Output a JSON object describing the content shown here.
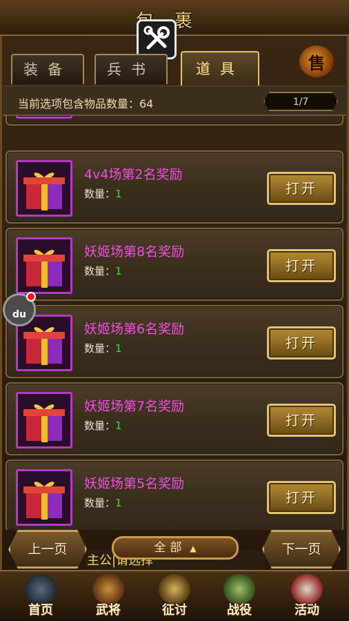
{
  "window": {
    "title": "包裹"
  },
  "tabs": [
    {
      "label": "装备",
      "active": false
    },
    {
      "label": "兵书",
      "active": false
    },
    {
      "label": "道具",
      "active": true
    }
  ],
  "sell_label": "售",
  "summary": {
    "count_text": "当前选项包含物品数量：64",
    "page": "1/7"
  },
  "items": [
    {
      "name": "4v4场第2名奖励",
      "qty_label": "数量：",
      "qty": "1",
      "action": "打开"
    },
    {
      "name": "妖姬场第8名奖励",
      "qty_label": "数量：",
      "qty": "1",
      "action": "打开"
    },
    {
      "name": "妖姬场第6名奖励",
      "qty_label": "数量：",
      "qty": "1",
      "action": "打开"
    },
    {
      "name": "妖姬场第7名奖励",
      "qty_label": "数量：",
      "qty": "1",
      "action": "打开"
    },
    {
      "name": "妖姬场第5名奖励",
      "qty_label": "数量：",
      "qty": "1",
      "action": "打开"
    }
  ],
  "controls": {
    "prev": "上一页",
    "next": "下一页",
    "filter": "全部",
    "ticker": "主公|请选择"
  },
  "float_ball": "du",
  "nav": [
    {
      "label": "首页"
    },
    {
      "label": "武将"
    },
    {
      "label": "征讨"
    },
    {
      "label": "战役"
    },
    {
      "label": "活动"
    }
  ]
}
